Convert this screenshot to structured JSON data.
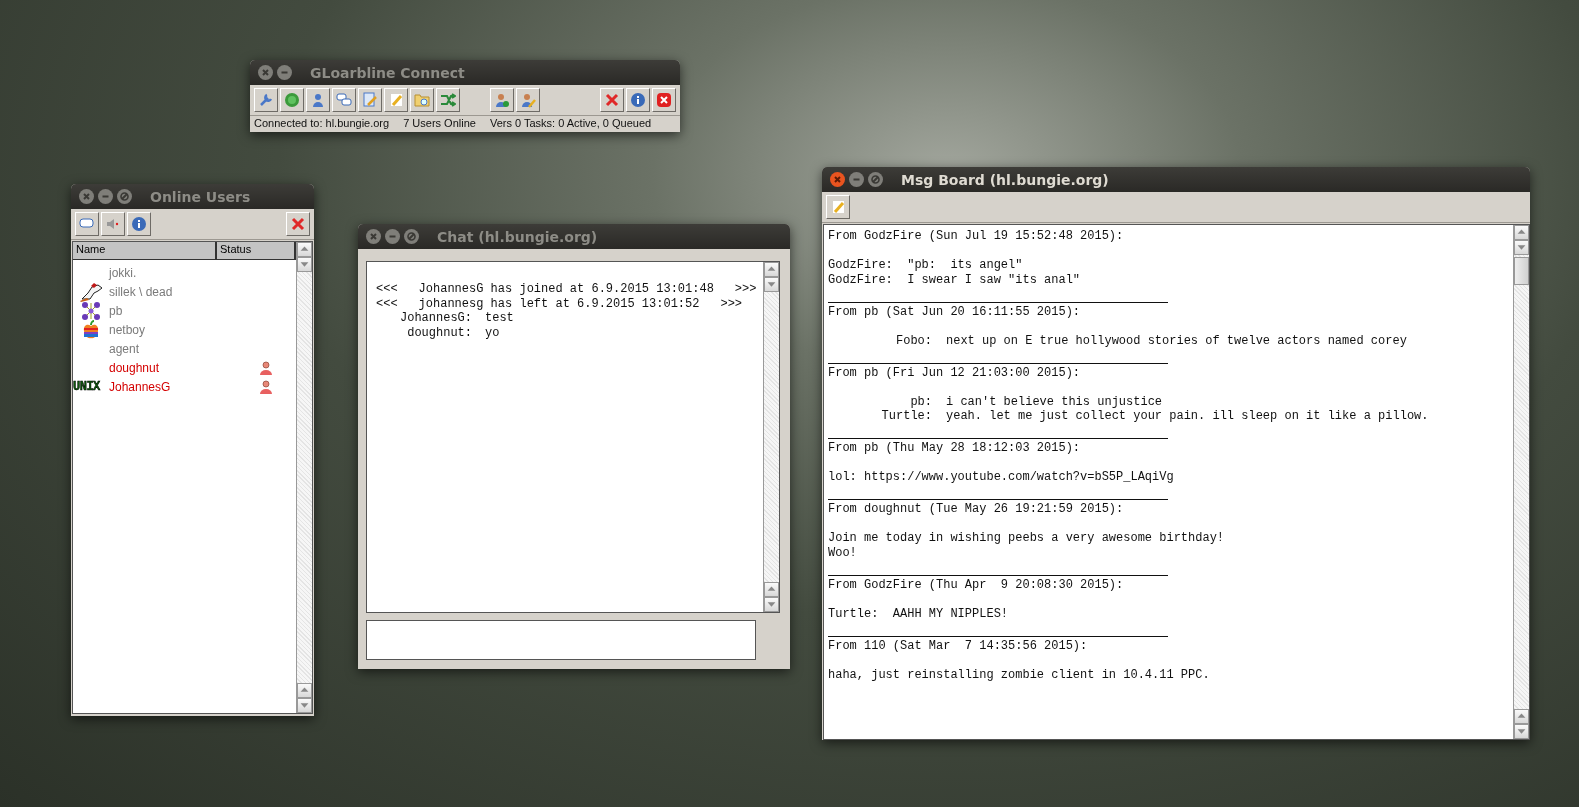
{
  "connect_window": {
    "title": "GLoarbline Connect",
    "active": false,
    "status_bar": [
      "Connected to: hl.bungie.org",
      "7 Users Online",
      "Vers 0 Tasks: 0 Active, 0 Queued"
    ]
  },
  "users_window": {
    "title": "Online Users",
    "active": false,
    "columns": [
      "Name",
      "Status"
    ],
    "users": [
      {
        "kind": "plain",
        "name": "jokki.",
        "color": "#7a7a7a",
        "status_icon": false
      },
      {
        "kind": "dog",
        "name": "sillek \\ dead",
        "color": "#7a7a7a",
        "status_icon": false
      },
      {
        "kind": "molecule",
        "name": "pb",
        "color": "#7a7a7a",
        "status_icon": false
      },
      {
        "kind": "apple",
        "name": "netboy",
        "color": "#7a7a7a",
        "status_icon": false
      },
      {
        "kind": "plain",
        "name": "agent",
        "color": "#7a7a7a",
        "status_icon": false
      },
      {
        "kind": "plain",
        "name": "doughnut",
        "color": "#d40000",
        "status_icon": true
      },
      {
        "kind": "badge",
        "name": "JohannesG",
        "color": "#d40000",
        "badge": "UNIX",
        "status_icon": true
      }
    ]
  },
  "chat_window": {
    "title": "Chat (hl.bungie.org)",
    "active": false,
    "lines": [
      {
        "kind": "event",
        "open": "<<<",
        "text": "JohannesG has joined at 6.9.2015 13:01:48",
        "close": ">>>"
      },
      {
        "kind": "event",
        "open": "<<<",
        "text": "johannesg has left at 6.9.2015 13:01:52",
        "close": ">>>"
      },
      {
        "kind": "message",
        "nick": "JohannesG:",
        "text": "test"
      },
      {
        "kind": "message",
        "nick": "doughnut:",
        "text": "yo"
      }
    ]
  },
  "board_window": {
    "title": "Msg Board (hl.bungie.org)",
    "active": true,
    "posts": [
      {
        "header": "From GodzFire (Sun Jul 19 15:52:48 2015):",
        "lines": [
          {
            "kind": "text",
            "text": "GodzFire:  \"pb:  its angel\""
          },
          {
            "kind": "text",
            "text": "GodzFire:  I swear I saw \"its anal\""
          }
        ]
      },
      {
        "header": "From pb (Sat Jun 20 16:11:55 2015):",
        "lines": [
          {
            "kind": "quote",
            "nick": "Fobo:",
            "text": "next up on E true hollywood stories of twelve actors named corey"
          }
        ]
      },
      {
        "header": "From pb (Fri Jun 12 21:03:00 2015):",
        "lines": [
          {
            "kind": "quote",
            "nick": "pb:",
            "text": "i can't believe this unjustice"
          },
          {
            "kind": "quote",
            "nick": "Turtle:",
            "text": "yeah. let me just collect your pain. ill sleep on it like a pillow."
          }
        ]
      },
      {
        "header": "From pb (Thu May 28 18:12:03 2015):",
        "lines": [
          {
            "kind": "text",
            "text": "lol: https://www.youtube.com/watch?v=bS5P_LAqiVg"
          }
        ]
      },
      {
        "header": "From doughnut (Tue May 26 19:21:59 2015):",
        "lines": [
          {
            "kind": "text",
            "text": "Join me today in wishing peebs a very awesome birthday!"
          },
          {
            "kind": "text",
            "text": "Woo!"
          }
        ]
      },
      {
        "header": "From GodzFire (Thu Apr  9 20:08:30 2015):",
        "lines": [
          {
            "kind": "text",
            "text": "Turtle:  AAHH MY NIPPLES!"
          }
        ]
      },
      {
        "header": "From 110 (Sat Mar  7 14:35:56 2015):",
        "lines": [
          {
            "kind": "text",
            "text": "haha, just reinstalling zombie client in 10.4.11 PPC."
          }
        ]
      }
    ]
  }
}
